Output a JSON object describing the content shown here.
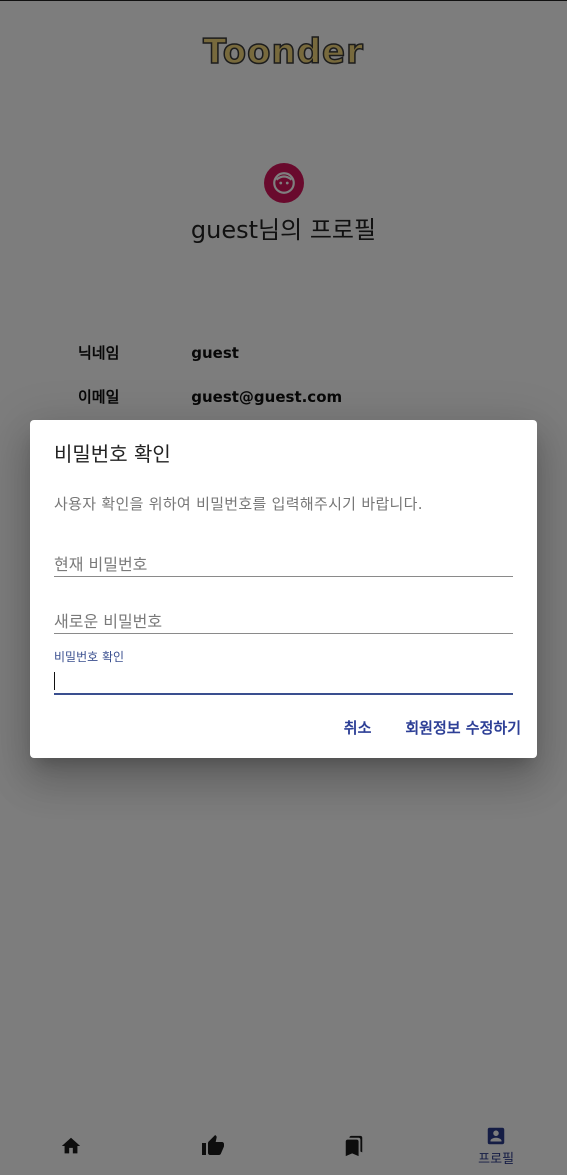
{
  "app": {
    "logo": "Toonder"
  },
  "profile": {
    "title": "guest님의 프로필",
    "rows": [
      {
        "label": "닉네임",
        "value": "guest"
      },
      {
        "label": "이메일",
        "value": "guest@guest.com"
      }
    ]
  },
  "dialog": {
    "title": "비밀번호 확인",
    "text": "사용자 확인을 위하여 비밀번호를 입력해주시기 바랍니다.",
    "current_password_placeholder": "현재 비밀번호",
    "new_password_placeholder": "새로운 비밀번호",
    "confirm_password_label": "비밀번호 확인",
    "confirm_password_value": "",
    "cancel_label": "취소",
    "submit_label": "회원정보 수정하기"
  },
  "nav": {
    "items": [
      {
        "icon": "home-icon",
        "label": ""
      },
      {
        "icon": "thumb-up-icon",
        "label": ""
      },
      {
        "icon": "bookmarks-icon",
        "label": ""
      },
      {
        "icon": "account-box-icon",
        "label": "프로필"
      }
    ]
  },
  "colors": {
    "accent": "#2d3f96",
    "avatar": "#d3145a",
    "logo": "#f1d57a"
  }
}
